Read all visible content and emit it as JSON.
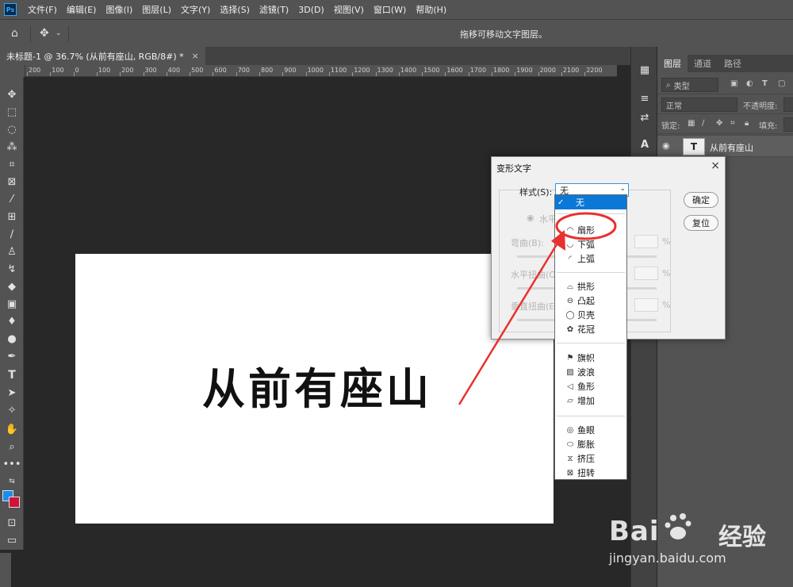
{
  "app": {
    "logo": "Ps",
    "menus": [
      "文件(F)",
      "编辑(E)",
      "图像(I)",
      "图层(L)",
      "文字(Y)",
      "选择(S)",
      "滤镜(T)",
      "3D(D)",
      "视图(V)",
      "窗口(W)",
      "帮助(H)"
    ]
  },
  "options_bar": {
    "status": "拖移可移动文字图层。",
    "icons": [
      "home-icon",
      "move-icon",
      "chevron-down-icon"
    ]
  },
  "document_tab": {
    "title": "未标题-1 @ 36.7% (从前有座山, RGB/8#) *",
    "close": "×"
  },
  "ruler": {
    "ticks": [
      "200",
      "100",
      "0",
      "100",
      "200",
      "300",
      "400",
      "500",
      "600",
      "700",
      "800",
      "900",
      "1000",
      "1100",
      "1200",
      "1300",
      "1400",
      "1500",
      "1600",
      "1700",
      "1800",
      "1900",
      "2000",
      "2100",
      "2200"
    ]
  },
  "toolbar": {
    "tools": [
      "move-tool",
      "marquee-tool",
      "lasso-tool",
      "magic-wand-tool",
      "crop-tool",
      "frame-tool",
      "eyedropper-tool",
      "healing-tool",
      "brush-tool",
      "stamp-tool",
      "history-brush-tool",
      "eraser-tool",
      "gradient-tool",
      "blur-tool",
      "dodge-tool",
      "pen-tool",
      "type-tool",
      "path-select-tool",
      "shape-tool",
      "hand-tool",
      "zoom-tool",
      "more-tools"
    ],
    "foreground_color": "#1a8ef0",
    "background_color": "#d1123a"
  },
  "canvas": {
    "text": "从前有座山"
  },
  "layers_panel": {
    "tabs": [
      "图层",
      "通道",
      "路径"
    ],
    "filter_kind": "类型",
    "blend_mode": "正常",
    "opacity_label": "不透明度:",
    "lock_label": "锁定:",
    "fill_label": "填充:",
    "layer": {
      "name": "从前有座山",
      "thumb": "T"
    }
  },
  "dialog": {
    "title": "变形文字",
    "close": "×",
    "style_label": "样式(S):",
    "style_value": "无",
    "ok_label": "确定",
    "reset_label": "复位",
    "horizontal_label": "水平",
    "bend_label": "弯曲(B):",
    "h_distort_label": "水平扭曲(O",
    "v_distort_label": "垂直扭曲(E",
    "percent": "%"
  },
  "style_list": {
    "selected": "无",
    "check": "✓",
    "groups": [
      [
        "扇形",
        "下弧",
        "上弧"
      ],
      [
        "拱形",
        "凸起",
        "贝壳",
        "花冠"
      ],
      [
        "旗帜",
        "波浪",
        "鱼形",
        "增加"
      ],
      [
        "鱼眼",
        "膨胀",
        "挤压",
        "扭转"
      ]
    ]
  },
  "annotation": {
    "color": "#e8312f"
  },
  "watermark": {
    "brand": "Bai",
    "cn": "经验",
    "url": "jingyan.baidu.com"
  }
}
